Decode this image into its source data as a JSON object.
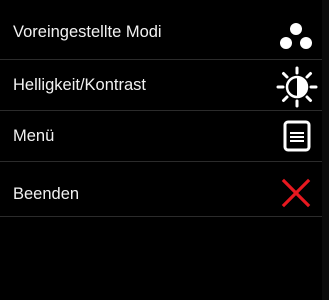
{
  "menu": {
    "items": [
      {
        "label": "Voreingestellte Modi",
        "icon": "preset-modes-icon"
      },
      {
        "label": "Helligkeit/Kontrast",
        "icon": "brightness-contrast-icon"
      },
      {
        "label": "Menü",
        "icon": "menu-icon"
      },
      {
        "label": "Beenden",
        "icon": "close-icon"
      }
    ]
  },
  "colors": {
    "background": "#000000",
    "text": "#f2f2f2",
    "icon": "#ffffff",
    "exit_icon": "#e8181f",
    "divider": "#2b2b2b"
  }
}
